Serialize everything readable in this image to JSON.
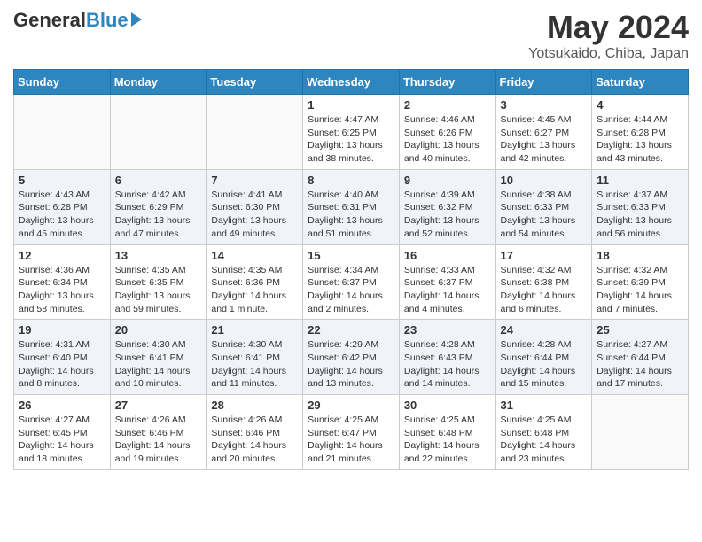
{
  "header": {
    "logo_general": "General",
    "logo_blue": "Blue",
    "month_title": "May 2024",
    "subtitle": "Yotsukaido, Chiba, Japan"
  },
  "days_of_week": [
    "Sunday",
    "Monday",
    "Tuesday",
    "Wednesday",
    "Thursday",
    "Friday",
    "Saturday"
  ],
  "weeks": [
    [
      {
        "day": "",
        "info": ""
      },
      {
        "day": "",
        "info": ""
      },
      {
        "day": "",
        "info": ""
      },
      {
        "day": "1",
        "info": "Sunrise: 4:47 AM\nSunset: 6:25 PM\nDaylight: 13 hours\nand 38 minutes."
      },
      {
        "day": "2",
        "info": "Sunrise: 4:46 AM\nSunset: 6:26 PM\nDaylight: 13 hours\nand 40 minutes."
      },
      {
        "day": "3",
        "info": "Sunrise: 4:45 AM\nSunset: 6:27 PM\nDaylight: 13 hours\nand 42 minutes."
      },
      {
        "day": "4",
        "info": "Sunrise: 4:44 AM\nSunset: 6:28 PM\nDaylight: 13 hours\nand 43 minutes."
      }
    ],
    [
      {
        "day": "5",
        "info": "Sunrise: 4:43 AM\nSunset: 6:28 PM\nDaylight: 13 hours\nand 45 minutes."
      },
      {
        "day": "6",
        "info": "Sunrise: 4:42 AM\nSunset: 6:29 PM\nDaylight: 13 hours\nand 47 minutes."
      },
      {
        "day": "7",
        "info": "Sunrise: 4:41 AM\nSunset: 6:30 PM\nDaylight: 13 hours\nand 49 minutes."
      },
      {
        "day": "8",
        "info": "Sunrise: 4:40 AM\nSunset: 6:31 PM\nDaylight: 13 hours\nand 51 minutes."
      },
      {
        "day": "9",
        "info": "Sunrise: 4:39 AM\nSunset: 6:32 PM\nDaylight: 13 hours\nand 52 minutes."
      },
      {
        "day": "10",
        "info": "Sunrise: 4:38 AM\nSunset: 6:33 PM\nDaylight: 13 hours\nand 54 minutes."
      },
      {
        "day": "11",
        "info": "Sunrise: 4:37 AM\nSunset: 6:33 PM\nDaylight: 13 hours\nand 56 minutes."
      }
    ],
    [
      {
        "day": "12",
        "info": "Sunrise: 4:36 AM\nSunset: 6:34 PM\nDaylight: 13 hours\nand 58 minutes."
      },
      {
        "day": "13",
        "info": "Sunrise: 4:35 AM\nSunset: 6:35 PM\nDaylight: 13 hours\nand 59 minutes."
      },
      {
        "day": "14",
        "info": "Sunrise: 4:35 AM\nSunset: 6:36 PM\nDaylight: 14 hours\nand 1 minute."
      },
      {
        "day": "15",
        "info": "Sunrise: 4:34 AM\nSunset: 6:37 PM\nDaylight: 14 hours\nand 2 minutes."
      },
      {
        "day": "16",
        "info": "Sunrise: 4:33 AM\nSunset: 6:37 PM\nDaylight: 14 hours\nand 4 minutes."
      },
      {
        "day": "17",
        "info": "Sunrise: 4:32 AM\nSunset: 6:38 PM\nDaylight: 14 hours\nand 6 minutes."
      },
      {
        "day": "18",
        "info": "Sunrise: 4:32 AM\nSunset: 6:39 PM\nDaylight: 14 hours\nand 7 minutes."
      }
    ],
    [
      {
        "day": "19",
        "info": "Sunrise: 4:31 AM\nSunset: 6:40 PM\nDaylight: 14 hours\nand 8 minutes."
      },
      {
        "day": "20",
        "info": "Sunrise: 4:30 AM\nSunset: 6:41 PM\nDaylight: 14 hours\nand 10 minutes."
      },
      {
        "day": "21",
        "info": "Sunrise: 4:30 AM\nSunset: 6:41 PM\nDaylight: 14 hours\nand 11 minutes."
      },
      {
        "day": "22",
        "info": "Sunrise: 4:29 AM\nSunset: 6:42 PM\nDaylight: 14 hours\nand 13 minutes."
      },
      {
        "day": "23",
        "info": "Sunrise: 4:28 AM\nSunset: 6:43 PM\nDaylight: 14 hours\nand 14 minutes."
      },
      {
        "day": "24",
        "info": "Sunrise: 4:28 AM\nSunset: 6:44 PM\nDaylight: 14 hours\nand 15 minutes."
      },
      {
        "day": "25",
        "info": "Sunrise: 4:27 AM\nSunset: 6:44 PM\nDaylight: 14 hours\nand 17 minutes."
      }
    ],
    [
      {
        "day": "26",
        "info": "Sunrise: 4:27 AM\nSunset: 6:45 PM\nDaylight: 14 hours\nand 18 minutes."
      },
      {
        "day": "27",
        "info": "Sunrise: 4:26 AM\nSunset: 6:46 PM\nDaylight: 14 hours\nand 19 minutes."
      },
      {
        "day": "28",
        "info": "Sunrise: 4:26 AM\nSunset: 6:46 PM\nDaylight: 14 hours\nand 20 minutes."
      },
      {
        "day": "29",
        "info": "Sunrise: 4:25 AM\nSunset: 6:47 PM\nDaylight: 14 hours\nand 21 minutes."
      },
      {
        "day": "30",
        "info": "Sunrise: 4:25 AM\nSunset: 6:48 PM\nDaylight: 14 hours\nand 22 minutes."
      },
      {
        "day": "31",
        "info": "Sunrise: 4:25 AM\nSunset: 6:48 PM\nDaylight: 14 hours\nand 23 minutes."
      },
      {
        "day": "",
        "info": ""
      }
    ]
  ]
}
